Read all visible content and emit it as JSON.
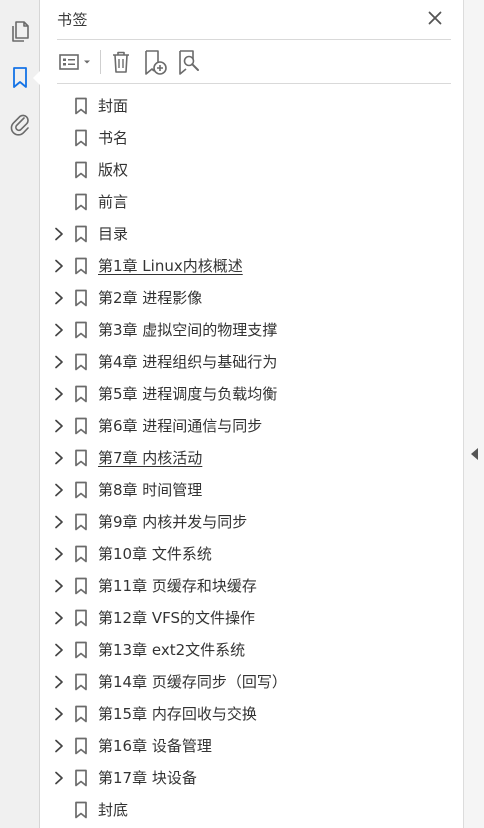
{
  "colors": {
    "accent": "#1473e6",
    "icon": "#6b6b6b",
    "text": "#333333",
    "rail_bg": "#f0f0f0"
  },
  "left_rail": {
    "items": [
      {
        "icon": "pages-icon"
      },
      {
        "icon": "bookmark-icon",
        "active": true
      },
      {
        "icon": "attachment-icon"
      }
    ]
  },
  "panel": {
    "title": "书签",
    "close_icon": "close-icon"
  },
  "toolbar": {
    "buttons": [
      {
        "icon": "options-menu-icon"
      },
      {
        "icon": "delete-icon"
      },
      {
        "icon": "new-bookmark-icon"
      },
      {
        "icon": "bookmark-search-icon"
      }
    ]
  },
  "bookmarks": [
    {
      "label": "封面",
      "expandable": false
    },
    {
      "label": "书名",
      "expandable": false
    },
    {
      "label": "版权",
      "expandable": false
    },
    {
      "label": "前言",
      "expandable": false
    },
    {
      "label": "目录",
      "expandable": true
    },
    {
      "label": "第1章  Linux内核概述",
      "expandable": true,
      "underlined": true
    },
    {
      "label": "第2章  进程影像",
      "expandable": true
    },
    {
      "label": "第3章  虚拟空间的物理支撑",
      "expandable": true
    },
    {
      "label": "第4章  进程组织与基础行为",
      "expandable": true
    },
    {
      "label": "第5章  进程调度与负载均衡",
      "expandable": true
    },
    {
      "label": "第6章  进程间通信与同步",
      "expandable": true
    },
    {
      "label": "第7章  内核活动",
      "expandable": true,
      "underlined": true
    },
    {
      "label": "第8章  时间管理",
      "expandable": true
    },
    {
      "label": "第9章  内核并发与同步",
      "expandable": true
    },
    {
      "label": "第10章  文件系统",
      "expandable": true
    },
    {
      "label": "第11章  页缓存和块缓存",
      "expandable": true
    },
    {
      "label": "第12章  VFS的文件操作",
      "expandable": true
    },
    {
      "label": "第13章  ext2文件系统",
      "expandable": true
    },
    {
      "label": "第14章  页缓存同步（回写）",
      "expandable": true
    },
    {
      "label": "第15章  内存回收与交换",
      "expandable": true
    },
    {
      "label": "第16章  设备管理",
      "expandable": true
    },
    {
      "label": "第17章  块设备",
      "expandable": true
    },
    {
      "label": "封底",
      "expandable": false
    }
  ],
  "right_gutter": {
    "handle_icon": "collapse-left-arrow-icon"
  }
}
